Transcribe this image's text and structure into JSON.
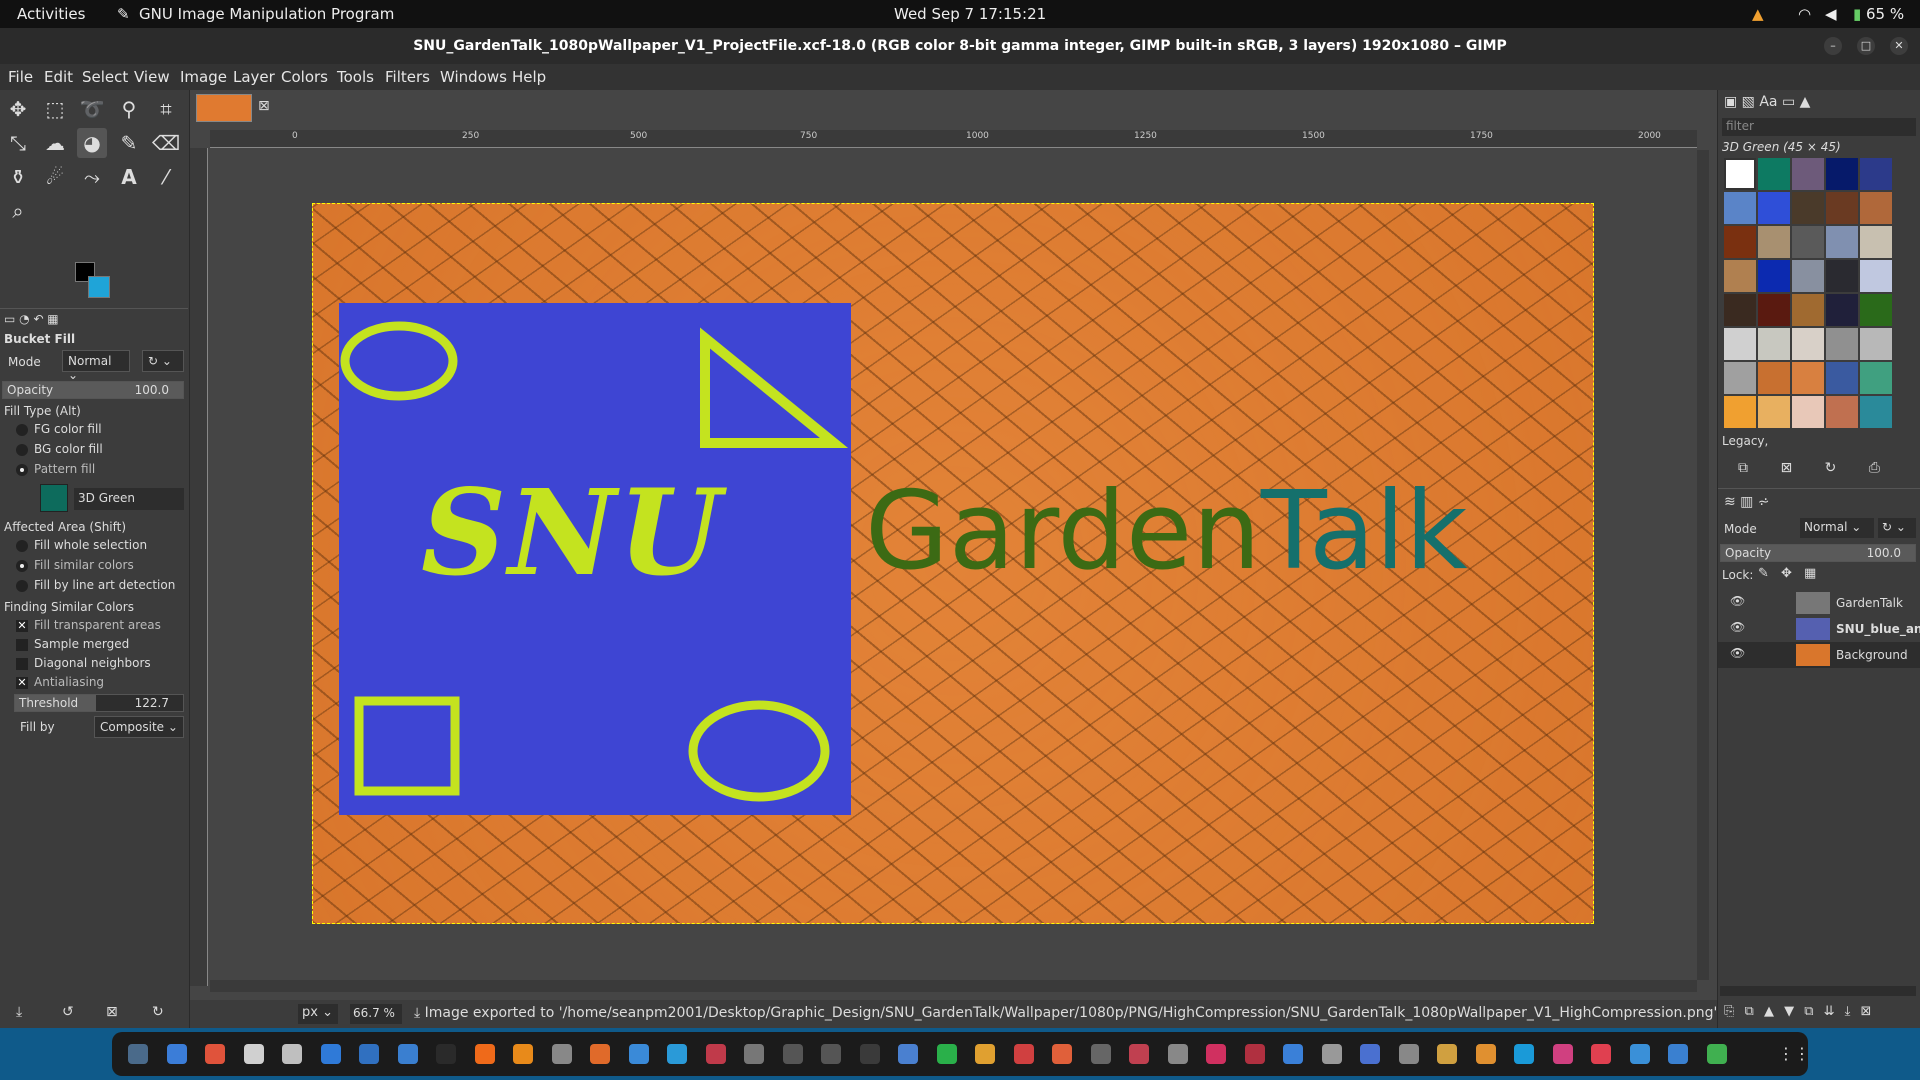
{
  "topbar": {
    "activities": "Activities",
    "app": "GNU Image Manipulation Program",
    "datetime": "Wed Sep 7  17:15:21",
    "battery": "65 %"
  },
  "window": {
    "title": "SNU_GardenTalk_1080pWallpaper_V1_ProjectFile.xcf-18.0 (RGB color 8-bit gamma integer, GIMP built-in sRGB, 3 layers) 1920x1080 – GIMP"
  },
  "menu": [
    "File",
    "Edit",
    "Select",
    "View",
    "Image",
    "Layer",
    "Colors",
    "Tools",
    "Filters",
    "Windows",
    "Help"
  ],
  "tool_options": {
    "title": "Bucket Fill",
    "mode_label": "Mode",
    "mode_value": "Normal",
    "opacity_label": "Opacity",
    "opacity_value": "100.0",
    "fill_type_label": "Fill Type  (Alt)",
    "fill_types": [
      "FG color fill",
      "BG color fill",
      "Pattern fill"
    ],
    "selected_fill_type": "Pattern fill",
    "pattern_name": "3D Green",
    "affected_label": "Affected Area  (Shift)",
    "affected": [
      "Fill whole selection",
      "Fill similar colors",
      "Fill by line art detection"
    ],
    "finding_label": "Finding Similar Colors",
    "finding": [
      "Fill transparent areas",
      "Sample merged",
      "Diagonal neighbors",
      "Antialiasing"
    ],
    "threshold_label": "Threshold",
    "threshold_value": "122.7",
    "fillby_label": "Fill by",
    "fillby_value": "Composite"
  },
  "ruler_ticks": [
    "0",
    "250",
    "500",
    "750",
    "1000",
    "1250",
    "1500",
    "1750",
    "2000"
  ],
  "canvas": {
    "snu": "SNU",
    "garden": "Garden",
    "talk": "Talk"
  },
  "status": {
    "unit": "px",
    "zoom": "66.7 %",
    "message": "Image exported to '/home/seanpm2001/Desktop/Graphic_Design/SNU_GardenTalk/Wallpaper/1080p/PNG/HighCompression/SNU_GardenTalk_1080pWallpaper_V1_HighCompression.png'"
  },
  "patterns": {
    "filter_placeholder": "filter",
    "selected": "3D Green (45 × 45)",
    "tag": "Legacy,"
  },
  "layers": {
    "mode_label": "Mode",
    "mode_value": "Normal",
    "opacity_label": "Opacity",
    "opacity_value": "100.0",
    "lock_label": "Lock:",
    "items": [
      "GardenTalk",
      "SNU_blue_and",
      "Background"
    ]
  },
  "colors": {
    "accent_fg": "#000000",
    "accent_bg": "#1fa4d8",
    "canvas_bg": "#d9762c",
    "snu_blue": "#3e45d3",
    "snu_green": "#c4e31f"
  }
}
